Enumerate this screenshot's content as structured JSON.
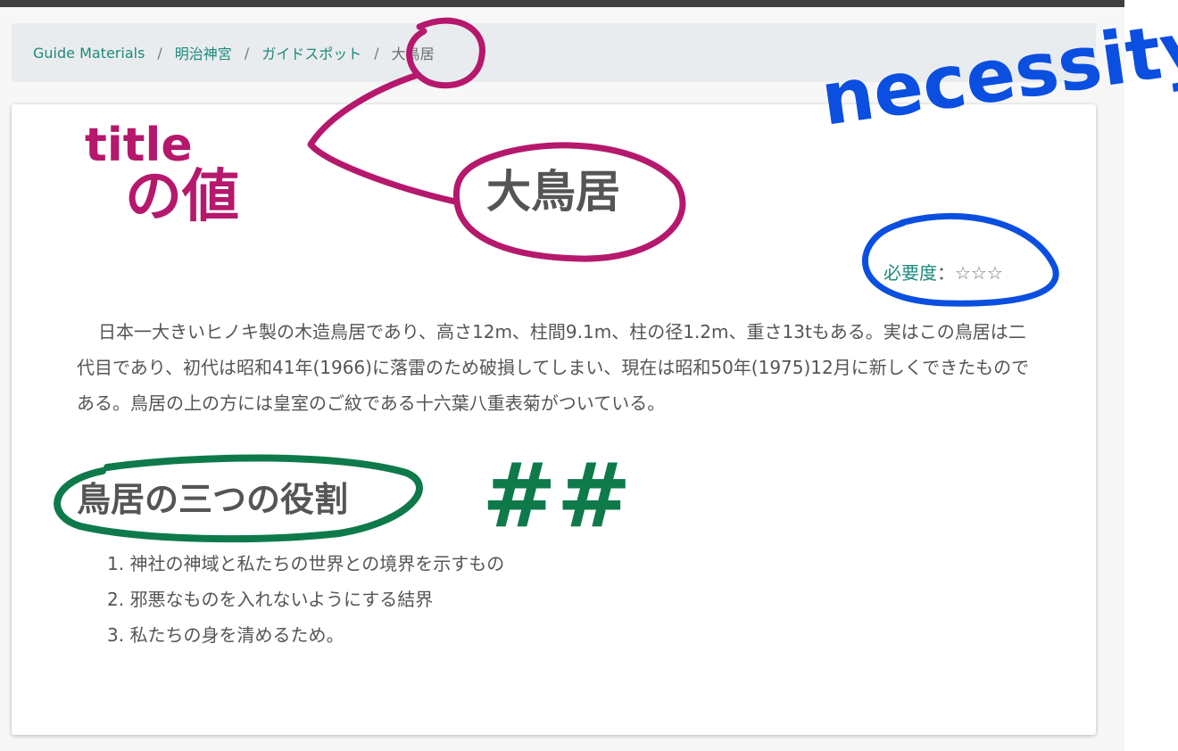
{
  "breadcrumb": {
    "items": [
      "Guide Materials",
      "明治神宮",
      "ガイドスポット"
    ],
    "current": "大鳥居",
    "separator": "/"
  },
  "page": {
    "title": "大鳥居",
    "necessity": {
      "label": "必要度",
      "separator": "：",
      "stars": "☆☆☆"
    },
    "description": "日本一大きいヒノキ製の木造鳥居であり、高さ12m、柱間9.1m、柱の径1.2m、重さ13tもある。実はこの鳥居は二代目であり、初代は昭和41年(1966)に落雷のため破損してしまい、現在は昭和50年(1975)12月に新しくできたものである。鳥居の上の方には皇室のご紋である十六葉八重表菊がついている。",
    "section": {
      "title": "鳥居の三つの役割",
      "items": [
        "1. 神社の神域と私たちの世界との境界を示すもの",
        "2. 邪悪なものを入れないようにする結界",
        "3. 私たちの身を清めるため。"
      ]
    }
  },
  "annotations": {
    "title_note_line1": "title",
    "title_note_line2": "の値",
    "necessity_note": "necessity",
    "heading_note": "##",
    "colors": {
      "magenta": "#b5186c",
      "blue": "#0b4fe0",
      "green": "#0e7a4a"
    }
  },
  "theme": {
    "link": "#1c8a7a",
    "text": "#555555",
    "breadcrumb_bg": "#e9ecef"
  }
}
